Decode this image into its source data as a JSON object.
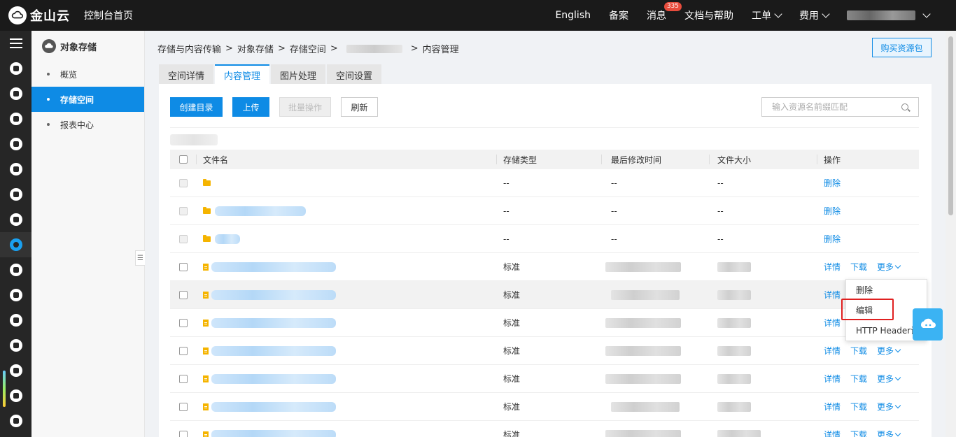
{
  "topbar": {
    "logo_text": "金山云",
    "console_home": "控制台首页",
    "links": [
      "English",
      "备案",
      "消息",
      "文档与帮助"
    ],
    "message_badge": "335",
    "dropdowns": [
      "工单",
      "费用"
    ]
  },
  "sidebar": {
    "title": "对象存储",
    "items": [
      {
        "label": "概览",
        "active": false
      },
      {
        "label": "存储空间",
        "active": true
      },
      {
        "label": "报表中心",
        "active": false
      }
    ]
  },
  "breadcrumb": {
    "items": [
      "存储与内容传输",
      "对象存储",
      "存储空间"
    ],
    "current": "内容管理"
  },
  "buy_button": "购买资源包",
  "tabs": [
    {
      "label": "空间详情",
      "active": false
    },
    {
      "label": "内容管理",
      "active": true
    },
    {
      "label": "图片处理",
      "active": false
    },
    {
      "label": "空间设置",
      "active": false
    }
  ],
  "toolbar": {
    "create_dir": "创建目录",
    "upload": "上传",
    "batch": "批量操作",
    "refresh": "刷新"
  },
  "search": {
    "placeholder": "输入资源名前缀匹配"
  },
  "table": {
    "headers": {
      "name": "文件名",
      "type": "存储类型",
      "modified": "最后修改时间",
      "size": "文件大小",
      "ops": "操作"
    },
    "empty_value": "--",
    "standard": "标准",
    "op_delete": "删除",
    "op_detail": "详情",
    "op_download": "下载",
    "op_more": "更多"
  },
  "dropdown": {
    "items": [
      "删除",
      "编辑",
      "HTTP Header设置"
    ]
  },
  "colors": {
    "accent": "#0e8be5",
    "highlight": "#e02020",
    "folder": "#f5b400"
  }
}
